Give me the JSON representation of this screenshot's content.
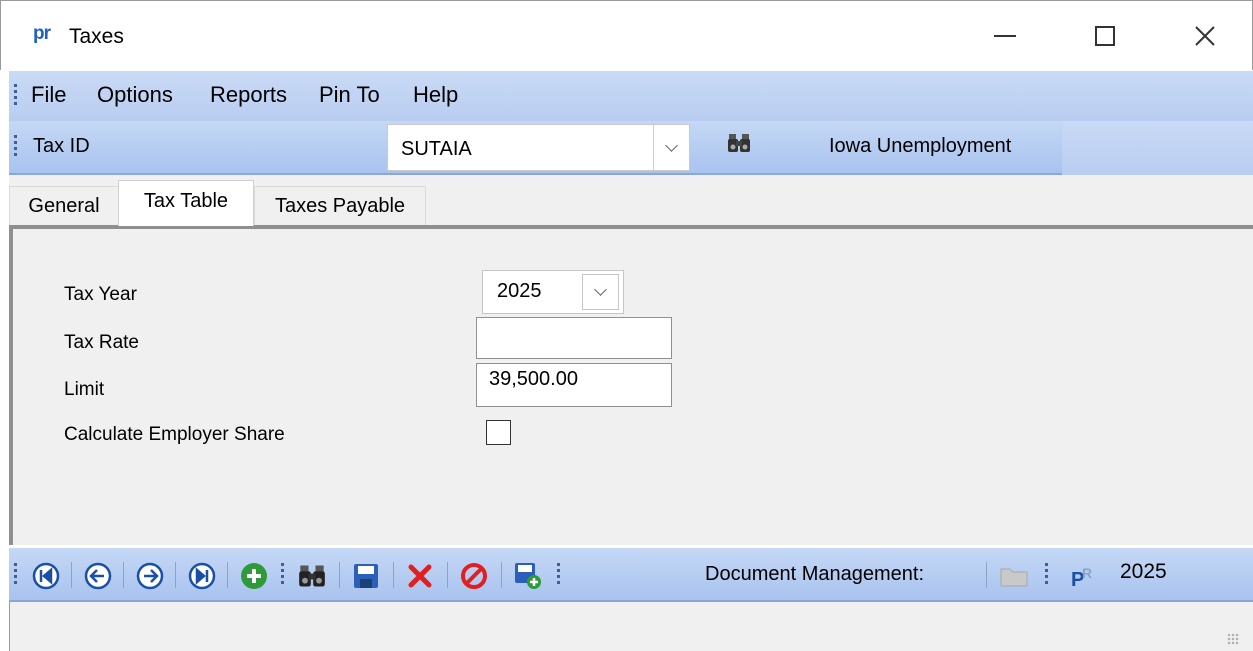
{
  "window": {
    "logo": "pr",
    "title": "Taxes"
  },
  "menu": {
    "items": [
      "File",
      "Options",
      "Reports",
      "Pin To",
      "Help"
    ]
  },
  "id_bar": {
    "label": "Tax ID",
    "value": "SUTAIA",
    "description": "Iowa Unemployment"
  },
  "tabs": [
    {
      "label": "General"
    },
    {
      "label": "Tax Table"
    },
    {
      "label": "Taxes Payable"
    }
  ],
  "form": {
    "tax_year_label": "Tax Year",
    "tax_year_value": "2025",
    "tax_rate_label": "Tax Rate",
    "tax_rate_value": "",
    "limit_label": "Limit",
    "limit_value": "39,500.00",
    "employer_share_label": "Calculate Employer Share",
    "employer_share_checked": false
  },
  "toolbar": {
    "doc_label": "Document Management:",
    "year": "2025"
  },
  "colors": {
    "toolbar_blue": "#b9cdf1",
    "nav_blue": "#1a4fa8",
    "add_green": "#2f9a3a",
    "delete_red": "#e02020"
  }
}
